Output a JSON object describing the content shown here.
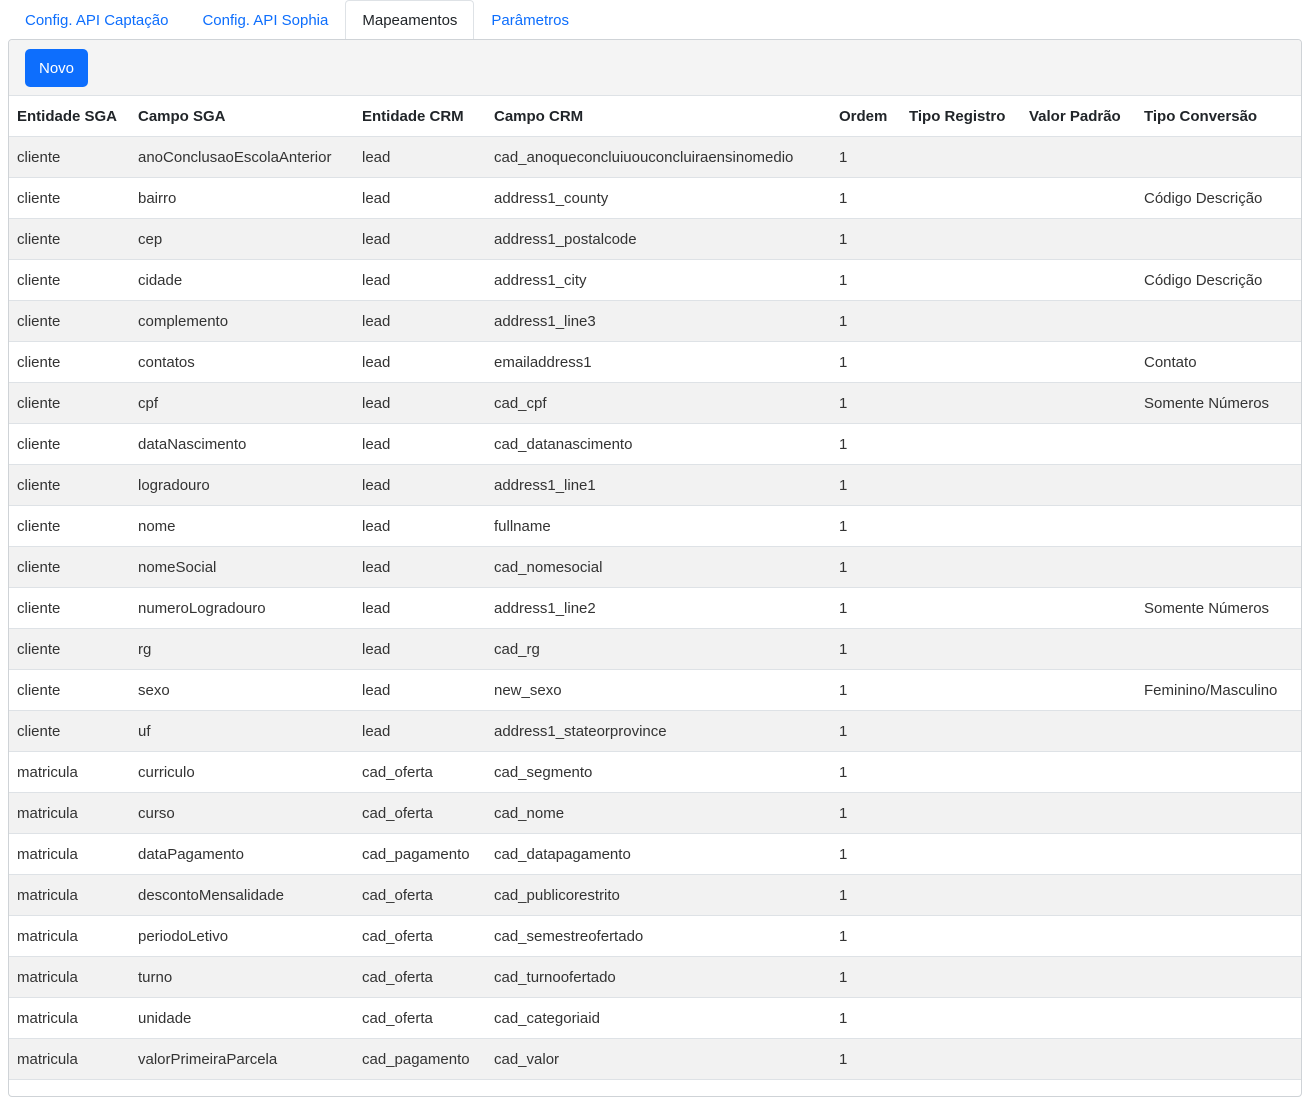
{
  "tabs": [
    {
      "label": "Config. API Captação",
      "active": false
    },
    {
      "label": "Config. API Sophia",
      "active": false
    },
    {
      "label": "Mapeamentos",
      "active": true
    },
    {
      "label": "Parâmetros",
      "active": false
    }
  ],
  "toolbar": {
    "new_label": "Novo"
  },
  "table": {
    "columns": [
      "Entidade SGA",
      "Campo SGA",
      "Entidade CRM",
      "Campo CRM",
      "Ordem",
      "Tipo Registro",
      "Valor Padrão",
      "Tipo Conversão"
    ],
    "rows": [
      [
        "cliente",
        "anoConclusaoEscolaAnterior",
        "lead",
        "cad_anoqueconcluiuouconcluiraensinomedio",
        "1",
        "",
        "",
        ""
      ],
      [
        "cliente",
        "bairro",
        "lead",
        "address1_county",
        "1",
        "",
        "",
        "Código Descrição"
      ],
      [
        "cliente",
        "cep",
        "lead",
        "address1_postalcode",
        "1",
        "",
        "",
        ""
      ],
      [
        "cliente",
        "cidade",
        "lead",
        "address1_city",
        "1",
        "",
        "",
        "Código Descrição"
      ],
      [
        "cliente",
        "complemento",
        "lead",
        "address1_line3",
        "1",
        "",
        "",
        ""
      ],
      [
        "cliente",
        "contatos",
        "lead",
        "emailaddress1",
        "1",
        "",
        "",
        "Contato"
      ],
      [
        "cliente",
        "cpf",
        "lead",
        "cad_cpf",
        "1",
        "",
        "",
        "Somente Números"
      ],
      [
        "cliente",
        "dataNascimento",
        "lead",
        "cad_datanascimento",
        "1",
        "",
        "",
        ""
      ],
      [
        "cliente",
        "logradouro",
        "lead",
        "address1_line1",
        "1",
        "",
        "",
        ""
      ],
      [
        "cliente",
        "nome",
        "lead",
        "fullname",
        "1",
        "",
        "",
        ""
      ],
      [
        "cliente",
        "nomeSocial",
        "lead",
        "cad_nomesocial",
        "1",
        "",
        "",
        ""
      ],
      [
        "cliente",
        "numeroLogradouro",
        "lead",
        "address1_line2",
        "1",
        "",
        "",
        "Somente Números"
      ],
      [
        "cliente",
        "rg",
        "lead",
        "cad_rg",
        "1",
        "",
        "",
        ""
      ],
      [
        "cliente",
        "sexo",
        "lead",
        "new_sexo",
        "1",
        "",
        "",
        "Feminino/Masculino"
      ],
      [
        "cliente",
        "uf",
        "lead",
        "address1_stateorprovince",
        "1",
        "",
        "",
        ""
      ],
      [
        "matricula",
        "curriculo",
        "cad_oferta",
        "cad_segmento",
        "1",
        "",
        "",
        ""
      ],
      [
        "matricula",
        "curso",
        "cad_oferta",
        "cad_nome",
        "1",
        "",
        "",
        ""
      ],
      [
        "matricula",
        "dataPagamento",
        "cad_pagamento",
        "cad_datapagamento",
        "1",
        "",
        "",
        ""
      ],
      [
        "matricula",
        "descontoMensalidade",
        "cad_oferta",
        "cad_publicorestrito",
        "1",
        "",
        "",
        ""
      ],
      [
        "matricula",
        "periodoLetivo",
        "cad_oferta",
        "cad_semestreofertado",
        "1",
        "",
        "",
        ""
      ],
      [
        "matricula",
        "turno",
        "cad_oferta",
        "cad_turnoofertado",
        "1",
        "",
        "",
        ""
      ],
      [
        "matricula",
        "unidade",
        "cad_oferta",
        "cad_categoriaid",
        "1",
        "",
        "",
        ""
      ],
      [
        "matricula",
        "valorPrimeiraParcela",
        "cad_pagamento",
        "cad_valor",
        "1",
        "",
        "",
        ""
      ]
    ]
  },
  "colors": {
    "accent": "#0d6efd",
    "stripe": "#f2f2f2",
    "toolbar_bg": "#f4f4f4",
    "border": "#dee2e6"
  }
}
